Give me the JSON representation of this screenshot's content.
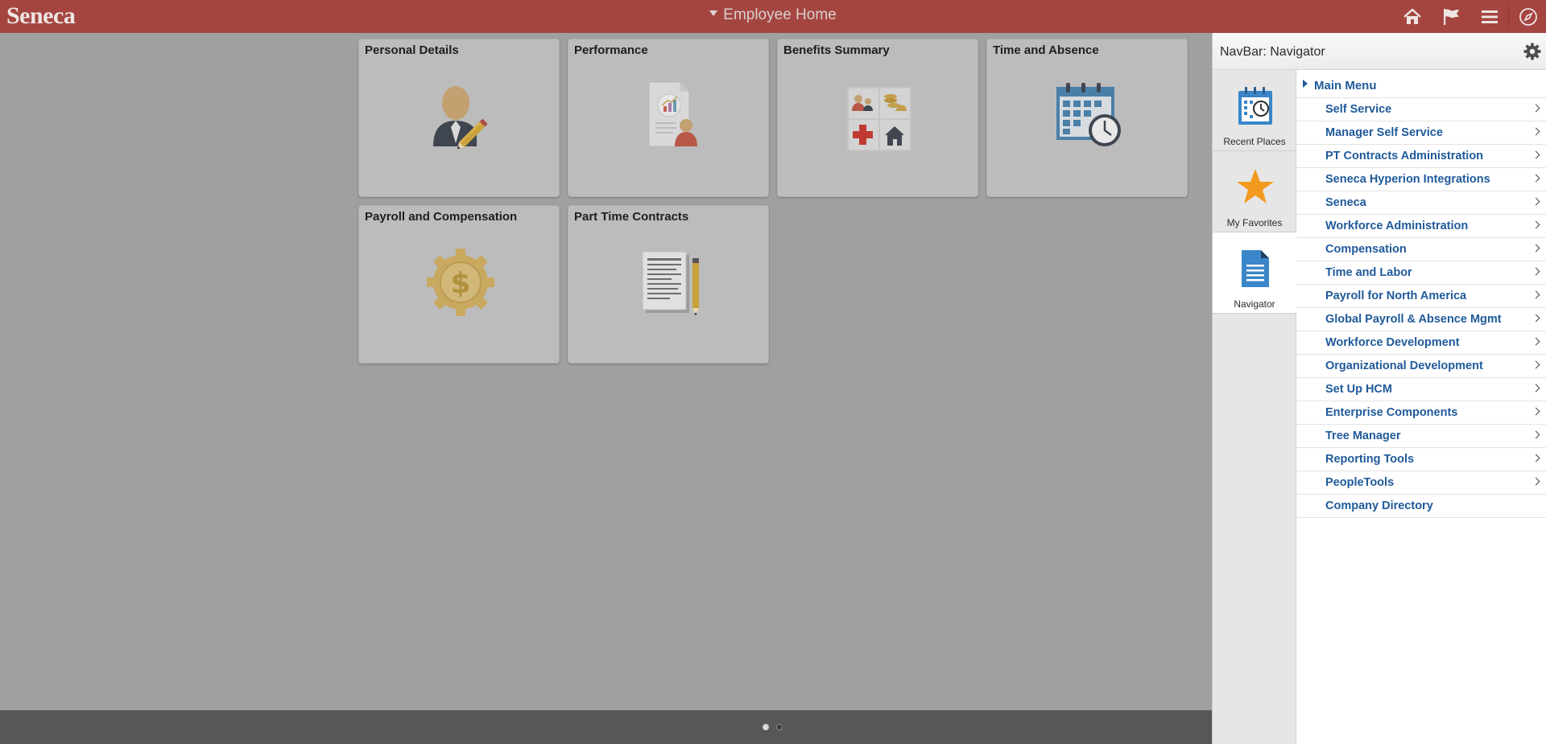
{
  "header": {
    "logo": "Seneca",
    "title": "Employee Home",
    "icons": [
      "home-icon",
      "flag-icon",
      "menu-icon",
      "compass-icon"
    ]
  },
  "tiles": [
    {
      "label": "Personal Details",
      "icon": "person-edit-icon"
    },
    {
      "label": "Performance",
      "icon": "performance-report-icon"
    },
    {
      "label": "Benefits Summary",
      "icon": "benefits-icon"
    },
    {
      "label": "Time and Absence",
      "icon": "calendar-clock-icon"
    },
    {
      "label": "Payroll and Compensation",
      "icon": "dollar-gear-icon"
    },
    {
      "label": "Part Time Contracts",
      "icon": "document-pencil-icon"
    }
  ],
  "footer": {
    "pages": 2,
    "current_page": 1
  },
  "navbar": {
    "title": "NavBar: Navigator",
    "side": [
      {
        "label": "Recent Places",
        "icon": "recent-places-icon"
      },
      {
        "label": "My Favorites",
        "icon": "star-icon"
      },
      {
        "label": "Navigator",
        "icon": "navigator-document-icon",
        "active": true
      }
    ],
    "main_menu": "Main Menu",
    "items": [
      {
        "label": "Self Service",
        "has_children": true
      },
      {
        "label": "Manager Self Service",
        "has_children": true
      },
      {
        "label": "PT Contracts Administration",
        "has_children": true
      },
      {
        "label": "Seneca Hyperion Integrations",
        "has_children": true
      },
      {
        "label": "Seneca",
        "has_children": true
      },
      {
        "label": "Workforce Administration",
        "has_children": true
      },
      {
        "label": "Compensation",
        "has_children": true
      },
      {
        "label": "Time and Labor",
        "has_children": true
      },
      {
        "label": "Payroll for North America",
        "has_children": true
      },
      {
        "label": "Global Payroll & Absence Mgmt",
        "has_children": true
      },
      {
        "label": "Workforce Development",
        "has_children": true
      },
      {
        "label": "Organizational Development",
        "has_children": true
      },
      {
        "label": "Set Up HCM",
        "has_children": true
      },
      {
        "label": "Enterprise Components",
        "has_children": true
      },
      {
        "label": "Tree Manager",
        "has_children": true
      },
      {
        "label": "Reporting Tools",
        "has_children": true
      },
      {
        "label": "PeopleTools",
        "has_children": true
      },
      {
        "label": "Company Directory",
        "has_children": false
      }
    ]
  }
}
